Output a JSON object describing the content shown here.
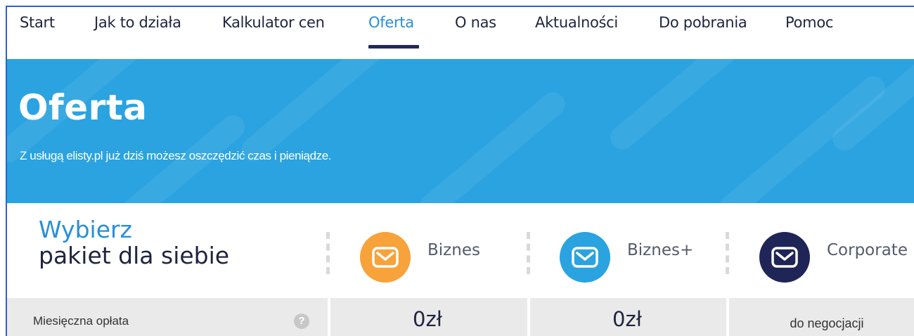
{
  "nav": {
    "items": [
      {
        "label": "Start",
        "active": false
      },
      {
        "label": "Jak to działa",
        "active": false
      },
      {
        "label": "Kalkulator cen",
        "active": false
      },
      {
        "label": "Oferta",
        "active": true
      },
      {
        "label": "O nas",
        "active": false
      },
      {
        "label": "Aktualności",
        "active": false
      },
      {
        "label": "Do pobrania",
        "active": false
      },
      {
        "label": "Pomoc",
        "active": false
      }
    ]
  },
  "hero": {
    "title": "Oferta",
    "subtitle": "Z usługą elisty.pl już dziś możesz oszczędzić czas i pieniądze.",
    "background": "#2aa3e0"
  },
  "packages": {
    "heading_line1": "Wybierz",
    "heading_line2": "pakiet dla siebie",
    "items": [
      {
        "name": "Biznes",
        "icon": "envelope-icon",
        "color": "#f7a23a"
      },
      {
        "name": "Biznes+",
        "icon": "envelope-icon",
        "color": "#2aa3e0"
      },
      {
        "name": "Corporate",
        "icon": "envelope-icon",
        "color": "#1f2557"
      }
    ]
  },
  "table": {
    "rows": [
      {
        "label": "Miesięczna opłata",
        "help_icon": "question-icon",
        "help_glyph": "?",
        "values": [
          "0zł",
          "0zł",
          "do negocjacji"
        ]
      }
    ]
  }
}
